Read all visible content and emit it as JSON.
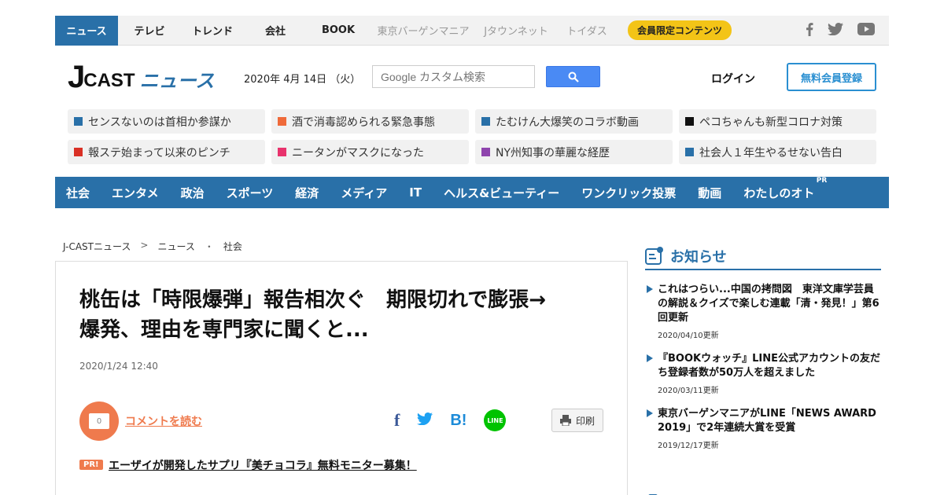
{
  "topnav": {
    "items": [
      "ニュース",
      "テレビ",
      "トレンド",
      "会社",
      "BOOK"
    ],
    "grey_items": [
      "東京バーゲンマニア",
      "Jタウンネット",
      "トイダス"
    ],
    "badge": "会員限定コンテンツ",
    "social": [
      "facebook-icon",
      "twitter-icon",
      "youtube-icon"
    ]
  },
  "header": {
    "logo_j": "J",
    "logo_cast": "CAST",
    "logo_news": "ニュース",
    "date": "2020年 4月 14日 （火）",
    "search_placeholder": "Google カスタム検索",
    "login": "ログイン",
    "register": "無料会員登録"
  },
  "trending": [
    {
      "text": "センスないのは首相か参謀か",
      "color": "#2970a8"
    },
    {
      "text": "酒で消毒認められる緊急事態",
      "color": "#ef6a3a"
    },
    {
      "text": "たむけん大爆笑のコラボ動画",
      "color": "#2970a8"
    },
    {
      "text": "ペコちゃんも新型コロナ対策",
      "color": "#111111"
    },
    {
      "text": "報ステ始まって以来のピンチ",
      "color": "#d93025"
    },
    {
      "text": "ニータンがマスクになった",
      "color": "#e8336d"
    },
    {
      "text": "NY州知事の華麗な経歴",
      "color": "#8e44ad"
    },
    {
      "text": "社会人１年生やるせない告白",
      "color": "#2970a8"
    }
  ],
  "catnav": {
    "items": [
      "社会",
      "エンタメ",
      "政治",
      "スポーツ",
      "経済",
      "メディア",
      "IT",
      "ヘルス&ビューティー",
      "ワンクリック投票",
      "動画",
      "わたしのオト"
    ],
    "pr": "PR"
  },
  "breadcrumb": {
    "home": "J-CASTニュース",
    "sep1": ">",
    "section": "ニュース",
    "sep2": "・",
    "category": "社会"
  },
  "article": {
    "title_line1": "桃缶は「時限爆弾」報告相次ぐ　期限切れで膨張→",
    "title_line2": "爆発、理由を専門家に聞くと...",
    "date": "2020/1/24 12:40",
    "comment_count": "0",
    "comment_link": "コメントを読む",
    "print": "印刷",
    "pr_badge": "PR!",
    "pr_text": "エーザイが開発したサプリ『美チョコラ』無料モニター募集！"
  },
  "share": {
    "fb": "f",
    "hatena": "B!",
    "line": "LINE"
  },
  "sidebar": {
    "notice_title": "お知らせ",
    "items": [
      {
        "text": "これはつらい...中国の拷問図　東洋文庫学芸員の解説＆クイズで楽しむ連載「清・発見！」第6回更新",
        "updated": "2020/04/10更新"
      },
      {
        "text": "『BOOKウォッチ』LINE公式アカウントの友だち登録者数が50万人を超えました",
        "updated": "2020/03/11更新"
      },
      {
        "text": "東京バーゲンマニアがLINE「NEWS AWARD 2019」で2年連続大賞を受賞",
        "updated": "2019/12/17更新"
      }
    ]
  }
}
